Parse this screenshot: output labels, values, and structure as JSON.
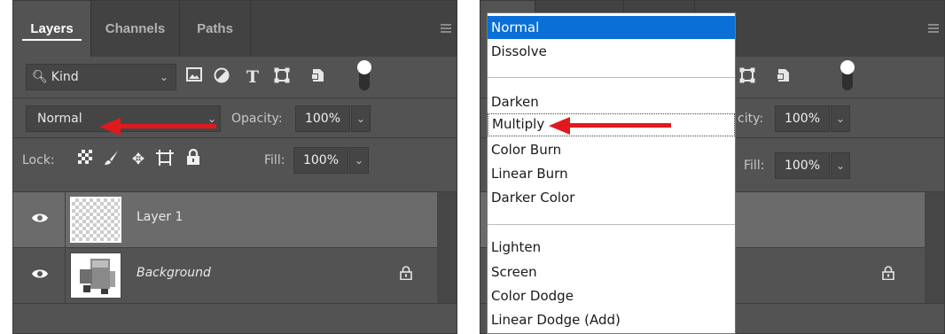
{
  "left": {
    "tabs": [
      {
        "label": "Layers",
        "active": true
      },
      {
        "label": "Channels",
        "active": false
      },
      {
        "label": "Paths",
        "active": false
      }
    ],
    "filter": {
      "kind_label": "Kind",
      "icons": [
        "image-filter-icon",
        "adjustment-filter-icon",
        "type-filter-icon",
        "shape-filter-icon",
        "smart-object-filter-icon"
      ]
    },
    "blend_mode": "Normal",
    "opacity_label": "Opacity:",
    "opacity_value": "100%",
    "lock_label": "Lock:",
    "fill_label": "Fill:",
    "fill_value": "100%",
    "layers": [
      {
        "name": "Layer 1",
        "selected": true,
        "italic": false
      },
      {
        "name": "Background",
        "selected": false,
        "italic": true,
        "locked": true
      }
    ]
  },
  "right": {
    "opacity_label": "city:",
    "opacity_value": "100%",
    "fill_label": "Fill:",
    "fill_value": "100%"
  },
  "blend_list": {
    "options": [
      "Normal",
      "Dissolve",
      "Darken",
      "Multiply",
      "Color Burn",
      "Linear Burn",
      "Darker Color",
      "Lighten",
      "Screen",
      "Color Dodge",
      "Linear Dodge (Add)"
    ],
    "highlighted": "Normal",
    "focused": "Multiply"
  },
  "colors": {
    "panel_bg": "#535353",
    "tab_bg": "#424242",
    "selected_row": "#6b6b6b",
    "highlight": "#0a6fd6",
    "arrow": "#e0191e"
  }
}
